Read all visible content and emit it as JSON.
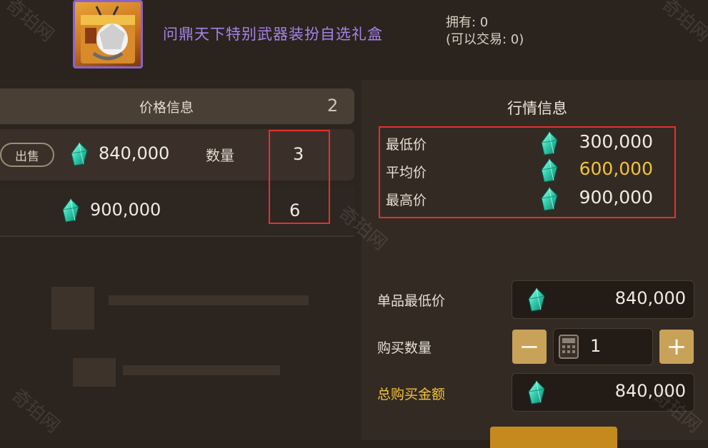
{
  "item": {
    "name": "问鼎天下特别武器装扮自选礼盒",
    "owned": "拥有: 0",
    "tradable": "(可以交易: 0)"
  },
  "price_panel": {
    "title": "价格信息",
    "count": "2",
    "sell_tag": "出售",
    "qty_label": "数量",
    "rows": [
      {
        "price": "840,000",
        "qty": "3"
      },
      {
        "price": "900,000",
        "qty": "6"
      }
    ]
  },
  "market": {
    "title": "行情信息",
    "min_label": "最低价",
    "min_value": "300,000",
    "avg_label": "平均价",
    "avg_value": "600,000",
    "max_label": "最高价",
    "max_value": "900,000"
  },
  "purchase": {
    "unit_min_label": "单品最低价",
    "unit_min_value": "840,000",
    "quantity_label": "购买数量",
    "quantity_value": "1",
    "total_label": "总购买金额",
    "total_value": "840,000"
  },
  "watermark": "奇珀网",
  "colors": {
    "gold": "#f2c23a",
    "purple_title": "#a782e8",
    "highlight_box": "#e3312f",
    "gem": "#3fd6b0"
  }
}
